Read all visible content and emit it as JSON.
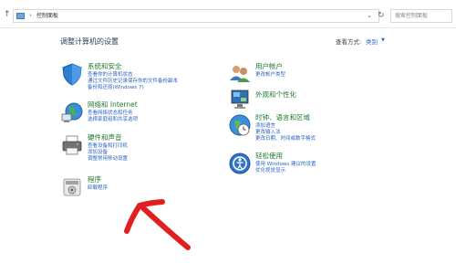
{
  "address_bar": {
    "up_icon": "up-arrow-icon",
    "breadcrumb_icon": "control-panel-icon",
    "breadcrumb_sep": "›",
    "breadcrumb": "控制面板",
    "dropdown_icon": "chevron-down-icon",
    "refresh_icon": "refresh-icon",
    "search_placeholder": "搜索控制面板"
  },
  "header": {
    "title": "调整计算机的设置",
    "view_by_label": "查看方式:",
    "view_by_value": "类别",
    "view_by_caret": "▼"
  },
  "categories": [
    {
      "title": "系统和安全",
      "icon": "shield-icon",
      "links": [
        "查看你的计算机状态",
        "通过文件历史记录保存你的文件备份副本",
        "备份和还原(Windows 7)"
      ]
    },
    {
      "title": "网络和 Internet",
      "icon": "network-icon",
      "links": [
        "查看网络状态和任务",
        "选择家庭组和共享选项"
      ]
    },
    {
      "title": "硬件和声音",
      "icon": "printer-icon",
      "links": [
        "查看设备和打印机",
        "添加设备",
        "调整常用移动设置"
      ]
    },
    {
      "title": "程序",
      "icon": "programs-icon",
      "links": [
        "卸载程序"
      ]
    },
    {
      "title": "用户帐户",
      "icon": "users-icon",
      "links": [
        "更改帐户类型"
      ]
    },
    {
      "title": "外观和个性化",
      "icon": "display-icon",
      "links": []
    },
    {
      "title": "时钟、语言和区域",
      "icon": "clock-globe-icon",
      "links": [
        "添加语言",
        "更改输入法",
        "更改日期、时间或数字格式"
      ]
    },
    {
      "title": "轻松使用",
      "icon": "ease-of-access-icon",
      "links": [
        "使用 Windows 建议的设置",
        "优化视觉显示"
      ]
    }
  ],
  "annotation": {
    "icon": "red-arrow-annotation",
    "color": "#e02020"
  }
}
